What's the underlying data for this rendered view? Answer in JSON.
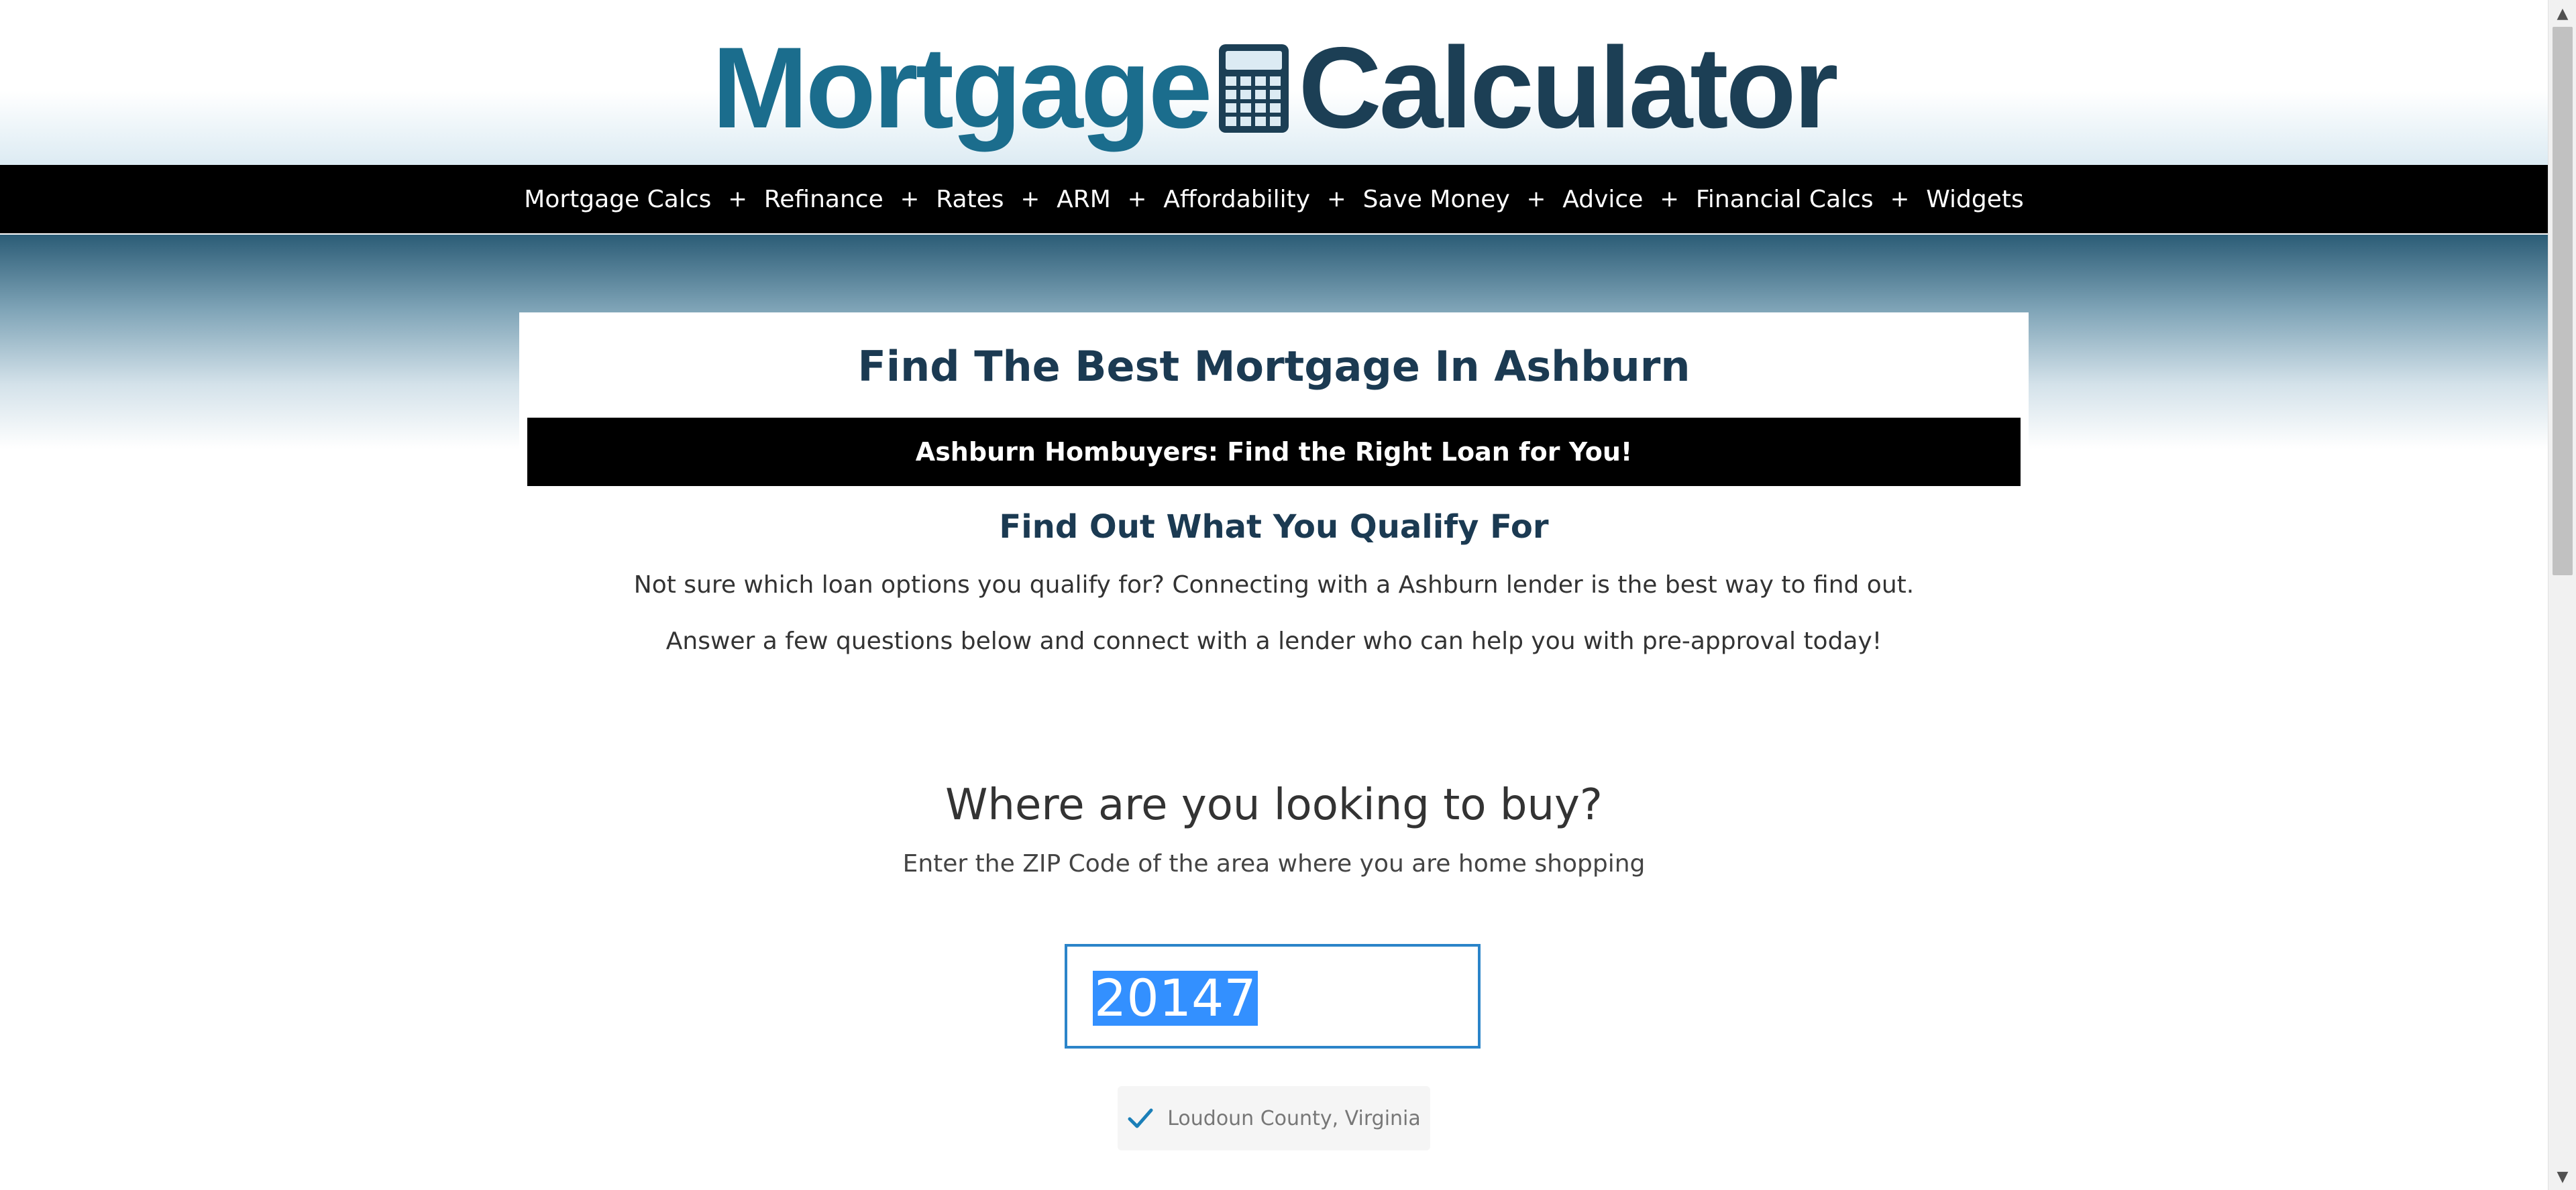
{
  "logo": {
    "word1": "Mortgage",
    "word2": "Calculator",
    "icon": "calculator-icon"
  },
  "nav": {
    "items": [
      "Mortgage Calcs",
      "Refinance",
      "Rates",
      "ARM",
      "Affordability",
      "Save Money",
      "Advice",
      "Financial Calcs",
      "Widgets"
    ],
    "separator": "+"
  },
  "main": {
    "title": "Find The Best Mortgage In Ashburn",
    "banner": "Ashburn Hombuyers: Find the Right Loan for You!",
    "subtitle": "Find Out What You Qualify For",
    "para1": "Not sure which loan options you qualify for? Connecting with a Ashburn lender is the best way to find out.",
    "para2": "Answer a few questions below and connect with a lender who can help you with pre-approval today!"
  },
  "form": {
    "question": "Where are you looking to buy?",
    "question_sub": "Enter the ZIP Code of the area where you are home shopping",
    "zip_value": "20147",
    "county": "Loudoun County, Virginia"
  },
  "colors": {
    "logo_blue": "#1b6d8d",
    "logo_dark": "#1c3f55",
    "heading": "#1b3a52",
    "input_border": "#2b84c9",
    "selection": "#3390ff",
    "check": "#1b7fb8"
  },
  "scrollbar": {
    "up_arrow": "▲",
    "down_arrow": "▼"
  }
}
